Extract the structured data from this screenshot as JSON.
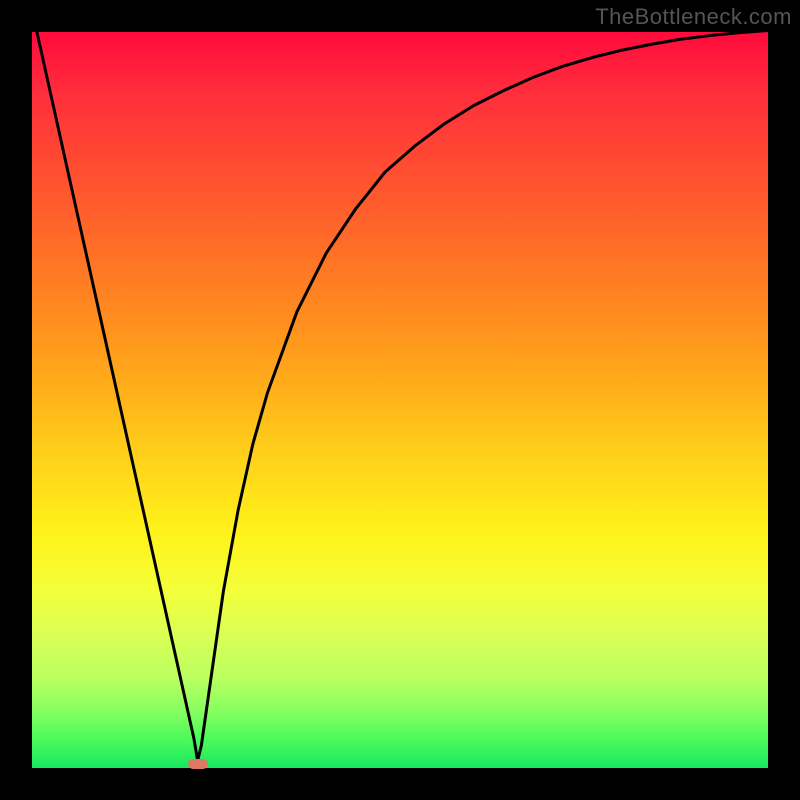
{
  "watermark": "TheBottleneck.com",
  "chart_data": {
    "type": "line",
    "title": "",
    "xlabel": "",
    "ylabel": "",
    "xlim": [
      0,
      100
    ],
    "ylim": [
      0,
      100
    ],
    "grid": false,
    "series": [
      {
        "name": "bottleneck-curve",
        "color": "#000000",
        "x": [
          0,
          2,
          4,
          6,
          8,
          10,
          12,
          14,
          16,
          18,
          20,
          22,
          22.5,
          23,
          24,
          26,
          28,
          30,
          32,
          36,
          40,
          44,
          48,
          52,
          56,
          60,
          64,
          68,
          72,
          76,
          80,
          84,
          88,
          92,
          96,
          100
        ],
        "values": [
          103,
          94,
          85,
          76,
          67,
          58,
          49,
          40,
          31,
          22,
          13,
          4,
          1,
          3,
          10,
          24,
          35,
          44,
          51,
          62,
          70,
          76,
          81,
          84.5,
          87.5,
          90,
          92,
          93.8,
          95.3,
          96.5,
          97.5,
          98.3,
          99,
          99.5,
          99.9,
          100.2
        ]
      }
    ],
    "annotations": [
      {
        "name": "min-marker",
        "x": 22.5,
        "y": 0.5,
        "color": "#e07866"
      }
    ],
    "background_gradient": {
      "top": "#ff0a3c",
      "bottom": "#18e862"
    }
  }
}
